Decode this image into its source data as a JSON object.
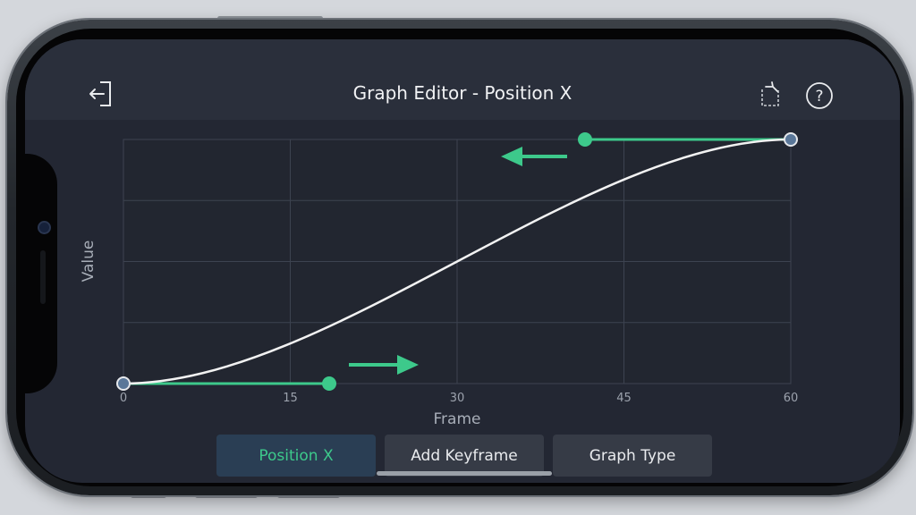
{
  "header": {
    "title": "Graph Editor - Position X",
    "back_icon": "exit-icon",
    "reset_icon": "reset-crop-icon",
    "help_icon": "help-icon"
  },
  "chart_data": {
    "type": "line",
    "xlabel": "Frame",
    "ylabel": "Value",
    "xlim": [
      0,
      60
    ],
    "ylim": [
      0,
      1
    ],
    "x_ticks": [
      "0",
      "15",
      "30",
      "45",
      "60"
    ],
    "grid": true,
    "keyframes": [
      {
        "frame": 0,
        "value": 0
      },
      {
        "frame": 60,
        "value": 1
      }
    ],
    "handles": [
      {
        "frame": 18.5,
        "value": 0
      },
      {
        "frame": 41.5,
        "value": 1
      }
    ],
    "series": [
      {
        "x": [
          0,
          5,
          10,
          15,
          20,
          25,
          30,
          35,
          40,
          45,
          50,
          55,
          60
        ],
        "values": [
          0,
          0.003,
          0.02,
          0.07,
          0.17,
          0.32,
          0.5,
          0.68,
          0.83,
          0.93,
          0.98,
          0.997,
          1
        ]
      }
    ]
  },
  "tabs": [
    {
      "label": "Position X",
      "active": true
    },
    {
      "label": "Add Keyframe",
      "active": false
    },
    {
      "label": "Graph Type",
      "active": false
    }
  ],
  "colors": {
    "accent": "#3dc98b",
    "curve": "#f2f2f2",
    "keyframe": "#5a7799",
    "grid": "#3d4350"
  }
}
